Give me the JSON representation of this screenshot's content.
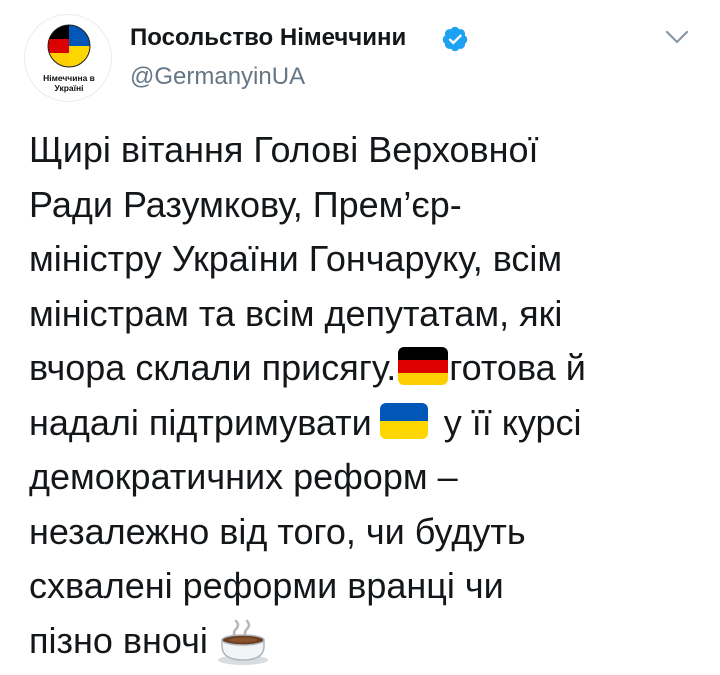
{
  "header": {
    "display_name": "Посольство Німеччини",
    "handle": "@GermanyinUA",
    "avatar_text_line1": "Німеччина в",
    "avatar_text_line2": "Україні",
    "verified": true
  },
  "tweet": {
    "lines": [
      "Щирі вітання Голові Верховної",
      "Ради Разумкову, Прем’єр-",
      "міністру України Гончаруку, всім",
      "міністрам та всім депутатам, які",
      "вчора склали присягу.",
      "готова й",
      "надалі підтримувати",
      "у її курсі",
      "демократичних реформ –",
      "незалежно від того, чи будуть",
      "схвалені реформи вранці чи",
      "пізно вночі"
    ],
    "emojis": [
      "germany-flag",
      "ukraine-flag",
      "hot-beverage"
    ]
  },
  "colors": {
    "verified_blue": "#1da1f2",
    "text": "#14171a",
    "secondary_text": "#657786",
    "de_black": "#000000",
    "de_red": "#dd0000",
    "de_gold": "#ffce00",
    "ua_blue": "#0057b7",
    "ua_yellow": "#ffd700"
  }
}
